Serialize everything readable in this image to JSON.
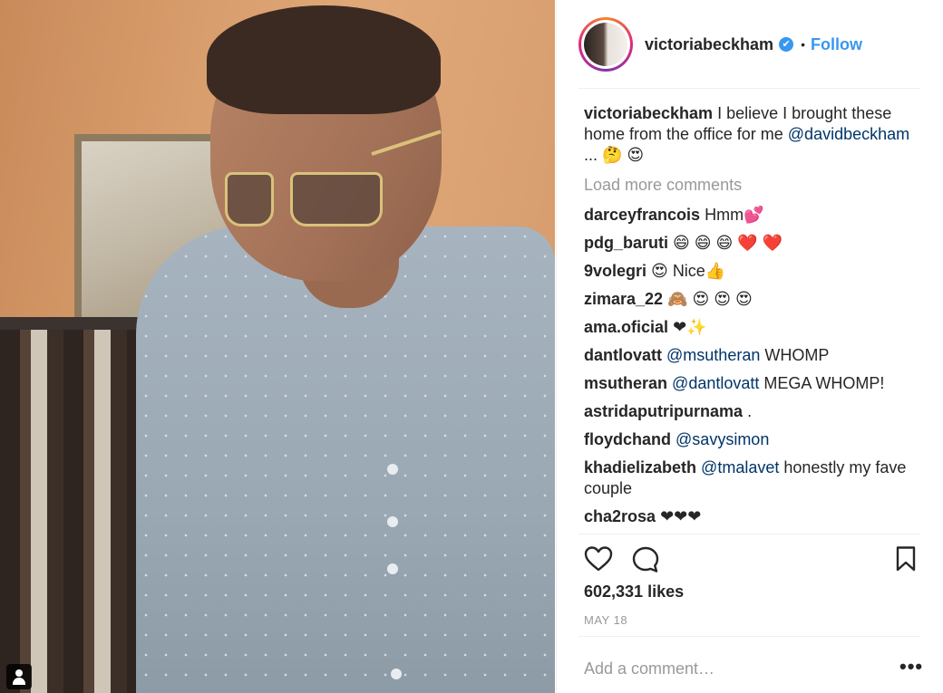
{
  "post": {
    "username": "victoriabeckham",
    "verified_icon": "✔",
    "dot": "•",
    "follow_label": "Follow"
  },
  "caption": {
    "user": "victoriabeckham",
    "text": "I believe I brought these home from the office for me",
    "mention": "@davidbeckham",
    "suffix": "... 🤔 😍"
  },
  "load_more": "Load more comments",
  "comments": [
    {
      "user": "darceyfrancois",
      "text": "Hmm💕"
    },
    {
      "user": "pdg_baruti",
      "text": "😄 😄 😄 ❤️ ❤️"
    },
    {
      "user": "9volegri",
      "text": "😍 Nice👍"
    },
    {
      "user": "zimara_22",
      "text": "🙈 😍 😍 😍"
    },
    {
      "user": "ama.oficial",
      "text": "❤✨"
    },
    {
      "user": "dantlovatt",
      "mention": "@msutheran",
      "text": "WHOMP"
    },
    {
      "user": "msutheran",
      "mention": "@dantlovatt",
      "text": "MEGA WHOMP!"
    },
    {
      "user": "astridaputripurnama",
      "text": "."
    },
    {
      "user": "floydchand",
      "mention": "@savysimon",
      "text": ""
    },
    {
      "user": "khadielizabeth",
      "mention": "@tmalavet",
      "text": "honestly my fave couple"
    },
    {
      "user": "cha2rosa",
      "text": "❤❤❤"
    }
  ],
  "likes": "602,331 likes",
  "date": "MAY 18",
  "add_comment_placeholder": "Add a comment…",
  "more_label": "•••",
  "icons": {
    "like": "heart-icon",
    "comment": "comment-bubble-icon",
    "save": "bookmark-icon",
    "user_tag": "user-tag-icon"
  },
  "colors": {
    "accent": "#3897f0",
    "mention": "#003569",
    "muted": "#999999"
  }
}
